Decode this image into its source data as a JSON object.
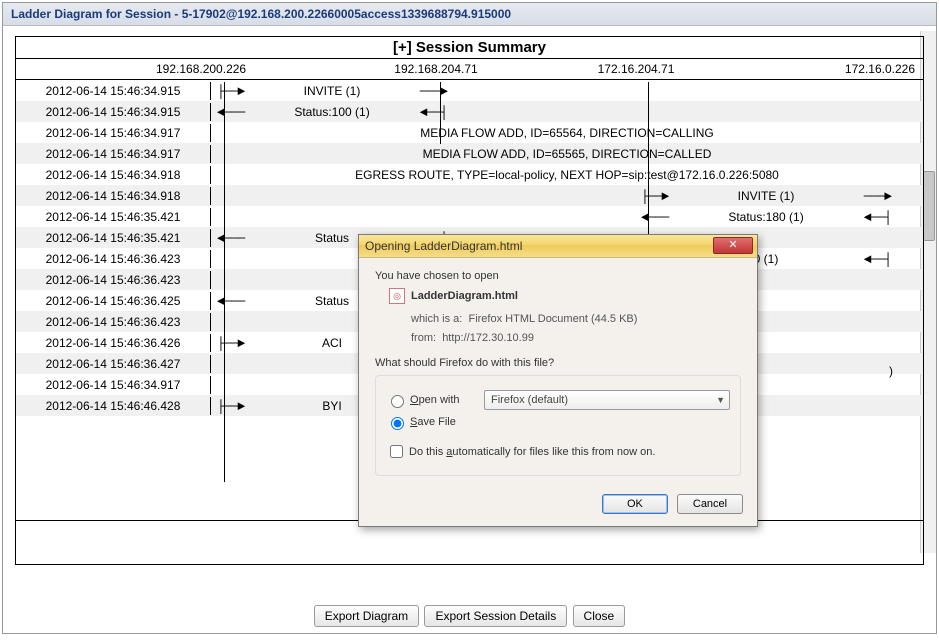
{
  "titlebar": "Ladder Diagram for Session - 5-17902@192.168.200.22660005access1339688794.915000",
  "summary_header": "[+] Session Summary",
  "ip_headers": [
    "192.168.200.226",
    "192.168.204.71",
    "172.16.204.71",
    "172.16.0.226"
  ],
  "rows": [
    {
      "ts": "2012-06-14 15:46:34.915",
      "msg": "INVITE (1)",
      "dir": "right",
      "lane": 1
    },
    {
      "ts": "2012-06-14 15:46:34.915",
      "msg": "Status:100 (1)",
      "dir": "left",
      "lane": 1
    },
    {
      "ts": "2012-06-14 15:46:34.917",
      "msg": "MEDIA FLOW ADD, ID=65564, DIRECTION=CALLING",
      "dir": "none",
      "lane": 0
    },
    {
      "ts": "2012-06-14 15:46:34.917",
      "msg": "MEDIA FLOW ADD, ID=65565, DIRECTION=CALLED",
      "dir": "none",
      "lane": 0
    },
    {
      "ts": "2012-06-14 15:46:34.918",
      "msg": "EGRESS ROUTE, TYPE=local-policy, NEXT HOP=sip:test@172.16.0.226:5080",
      "dir": "none",
      "lane": 0
    },
    {
      "ts": "2012-06-14 15:46:34.918",
      "msg": "INVITE (1)",
      "dir": "right",
      "lane": 3
    },
    {
      "ts": "2012-06-14 15:46:35.421",
      "msg": "Status:180 (1)",
      "dir": "left",
      "lane": 3
    },
    {
      "ts": "2012-06-14 15:46:35.421",
      "msg": "Status",
      "dir": "left",
      "lane": 1,
      "partial_right": true
    },
    {
      "ts": "2012-06-14 15:46:36.423",
      "msg": "",
      "dir": "left",
      "lane": 3,
      "partial_right_text": "0 (1)"
    },
    {
      "ts": "2012-06-14 15:46:36.423",
      "msg": "",
      "dir": "none",
      "lane": 0
    },
    {
      "ts": "2012-06-14 15:46:36.425",
      "msg": "Status",
      "dir": "left",
      "lane": 1
    },
    {
      "ts": "2012-06-14 15:46:36.423",
      "msg": "",
      "dir": "none",
      "lane": 0
    },
    {
      "ts": "2012-06-14 15:46:36.426",
      "msg": "ACI",
      "dir": "right",
      "lane": 1
    },
    {
      "ts": "2012-06-14 15:46:36.427",
      "msg": "",
      "dir": "none",
      "lane": 0,
      "partial_right_text": ")"
    },
    {
      "ts": "2012-06-14 15:46:34.917",
      "msg": "",
      "dir": "none",
      "lane": 0
    },
    {
      "ts": "2012-06-14 15:46:46.428",
      "msg": "BYI",
      "dir": "right",
      "lane": 1
    }
  ],
  "buttons": {
    "export_diagram": "Export Diagram",
    "export_details": "Export Session Details",
    "close": "Close"
  },
  "dialog": {
    "title": "Opening LadderDiagram.html",
    "intro": "You have chosen to open",
    "filename": "LadderDiagram.html",
    "whichis_label": "which is a:",
    "whichis_value": "Firefox HTML Document (44.5 KB)",
    "from_label": "from:",
    "from_value": "http://172.30.10.99",
    "question": "What should Firefox do with this file?",
    "open_with": "Open with",
    "open_with_app": "Firefox (default)",
    "save_file": "Save File",
    "auto_text_before": "Do this ",
    "auto_key": "a",
    "auto_text_after": "utomatically for files like this from now on.",
    "ok": "OK",
    "cancel": "Cancel"
  }
}
